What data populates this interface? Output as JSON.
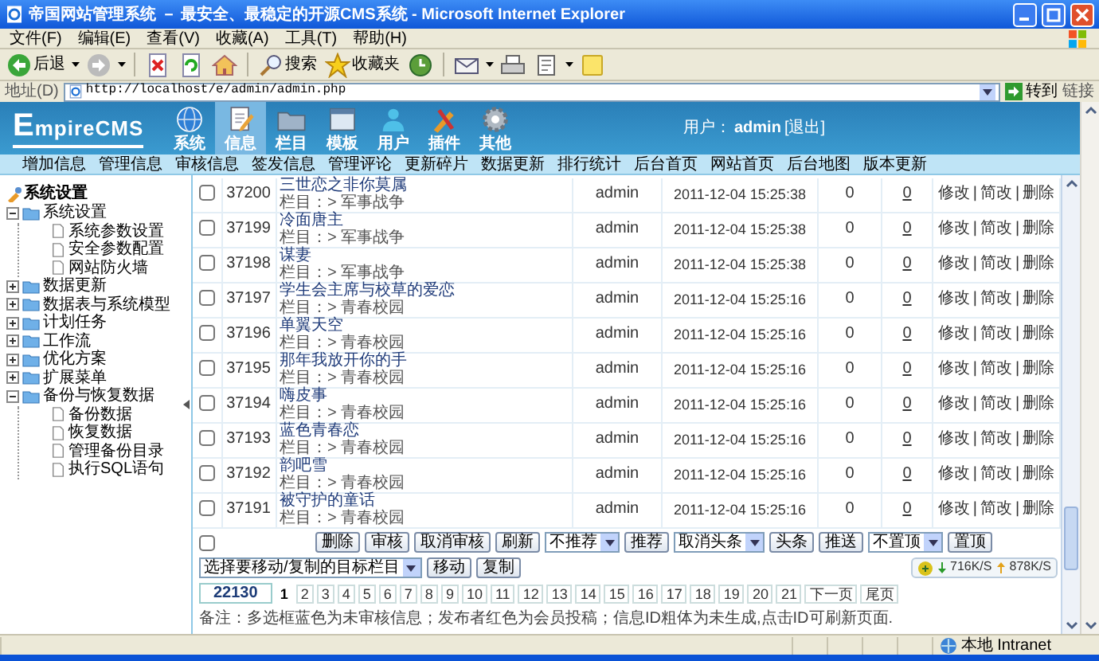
{
  "window": {
    "title": "帝国网站管理系统 － 最安全、最稳定的开源CMS系统 - Microsoft Internet Explorer"
  },
  "menu": [
    "文件(F)",
    "编辑(E)",
    "查看(V)",
    "收藏(A)",
    "工具(T)",
    "帮助(H)"
  ],
  "toolbar": [
    {
      "kind": "back",
      "label": "后退",
      "dropdown": true
    },
    {
      "kind": "forward",
      "dropdown": true
    },
    {
      "kind": "stop",
      "dropdown": false
    },
    {
      "kind": "refresh",
      "dropdown": false
    },
    {
      "kind": "home",
      "dropdown": false
    },
    {
      "kind": "search",
      "label": "搜索",
      "dropdown": false
    },
    {
      "kind": "favorites",
      "label": "收藏夹",
      "dropdown": false
    },
    {
      "kind": "history",
      "dropdown": false
    },
    {
      "kind": "mail",
      "dropdown": true
    },
    {
      "kind": "print",
      "dropdown": false
    },
    {
      "kind": "edit",
      "dropdown": true
    },
    {
      "kind": "note",
      "dropdown": false
    }
  ],
  "address_bar": {
    "label": "地址(D)",
    "url": "http://localhost/e/admin/admin.php",
    "go": "转到",
    "links": "链接"
  },
  "header": {
    "logo": "EmpireCMS",
    "user_label": "用户：",
    "user": "admin",
    "logout": "[退出]",
    "tabs": [
      {
        "kind": "globe",
        "label": "系统",
        "selected": false
      },
      {
        "kind": "document",
        "label": "信息",
        "selected": true
      },
      {
        "kind": "folder",
        "label": "栏目",
        "selected": false
      },
      {
        "kind": "template",
        "label": "模板",
        "selected": false
      },
      {
        "kind": "user",
        "label": "用户",
        "selected": false
      },
      {
        "kind": "plugin",
        "label": "插件",
        "selected": false
      },
      {
        "kind": "gear",
        "label": "其他",
        "selected": false
      }
    ]
  },
  "subnav": [
    "增加信息",
    "管理信息",
    "审核信息",
    "签发信息",
    "管理评论",
    "更新碎片",
    "数据更新",
    "排行统计",
    "后台首页",
    "网站首页",
    "后台地图",
    "版本更新"
  ],
  "sidebar": {
    "title": "系统设置",
    "items": [
      {
        "label": "系统设置",
        "expanded": true,
        "children": [
          {
            "label": "系统参数设置"
          },
          {
            "label": "安全参数配置"
          },
          {
            "label": "网站防火墙"
          }
        ]
      },
      {
        "label": "数据更新",
        "expanded": false
      },
      {
        "label": "数据表与系统模型",
        "expanded": false
      },
      {
        "label": "计划任务",
        "expanded": false
      },
      {
        "label": "工作流",
        "expanded": false
      },
      {
        "label": "优化方案",
        "expanded": false
      },
      {
        "label": "扩展菜单",
        "expanded": false
      },
      {
        "label": "备份与恢复数据",
        "expanded": true,
        "children": [
          {
            "label": "备份数据"
          },
          {
            "label": "恢复数据"
          },
          {
            "label": "管理备份目录"
          },
          {
            "label": "执行SQL语句"
          }
        ]
      }
    ]
  },
  "table": {
    "rows": [
      {
        "checked": false,
        "id": "37200",
        "title": "三世恋之非你莫属",
        "column": "栏目：> 军事战争",
        "author": "admin",
        "time": "2011-12-04 15:25:38",
        "column_6": "0",
        "column_7": "0",
        "actions": [
          "修改",
          "简改",
          "删除"
        ],
        "separator": "|"
      },
      {
        "checked": false,
        "id": "37199",
        "title": "冷面唐主",
        "column": "栏目：> 军事战争",
        "author": "admin",
        "time": "2011-12-04 15:25:38",
        "column_6": "0",
        "column_7": "0",
        "actions": [
          "修改",
          "简改",
          "删除"
        ],
        "separator": "|"
      },
      {
        "checked": false,
        "id": "37198",
        "title": "谋妻",
        "column": "栏目：> 军事战争",
        "author": "admin",
        "time": "2011-12-04 15:25:38",
        "column_6": "0",
        "column_7": "0",
        "actions": [
          "修改",
          "简改",
          "删除"
        ],
        "separator": "|"
      },
      {
        "checked": false,
        "id": "37197",
        "title": "学生会主席与校草的爱恋",
        "column": "栏目：> 青春校园",
        "author": "admin",
        "time": "2011-12-04 15:25:16",
        "column_6": "0",
        "column_7": "0",
        "actions": [
          "修改",
          "简改",
          "删除"
        ],
        "separator": "|"
      },
      {
        "checked": false,
        "id": "37196",
        "title": "单翼天空",
        "column": "栏目：> 青春校园",
        "author": "admin",
        "time": "2011-12-04 15:25:16",
        "column_6": "0",
        "column_7": "0",
        "actions": [
          "修改",
          "简改",
          "删除"
        ],
        "separator": "|"
      },
      {
        "checked": false,
        "id": "37195",
        "title": "那年我放开你的手",
        "column": "栏目：> 青春校园",
        "author": "admin",
        "time": "2011-12-04 15:25:16",
        "column_6": "0",
        "column_7": "0",
        "actions": [
          "修改",
          "简改",
          "删除"
        ],
        "separator": "|"
      },
      {
        "checked": false,
        "id": "37194",
        "title": "嗨皮事",
        "column": "栏目：> 青春校园",
        "author": "admin",
        "time": "2011-12-04 15:25:16",
        "column_6": "0",
        "column_7": "0",
        "actions": [
          "修改",
          "简改",
          "删除"
        ],
        "separator": "|"
      },
      {
        "checked": false,
        "id": "37193",
        "title": "蓝色青春恋",
        "column": "栏目：> 青春校园",
        "author": "admin",
        "time": "2011-12-04 15:25:16",
        "column_6": "0",
        "column_7": "0",
        "actions": [
          "修改",
          "简改",
          "删除"
        ],
        "separator": "|"
      },
      {
        "checked": false,
        "id": "37192",
        "title": "韵吧雪",
        "column": "栏目：> 青春校园",
        "author": "admin",
        "time": "2011-12-04 15:25:16",
        "column_6": "0",
        "column_7": "0",
        "actions": [
          "修改",
          "简改",
          "删除"
        ],
        "separator": "|"
      },
      {
        "checked": false,
        "id": "37191",
        "title": "被守护的童话",
        "column": "栏目：> 青春校园",
        "author": "admin",
        "time": "2011-12-04 15:25:16",
        "column_6": "0",
        "column_7": "0",
        "actions": [
          "修改",
          "简改",
          "删除"
        ],
        "separator": "|"
      }
    ]
  },
  "bulk_actions": {
    "select_all_checked": false,
    "controls": [
      {
        "kind": "button",
        "label": "删除"
      },
      {
        "kind": "button",
        "label": "审核"
      },
      {
        "kind": "button",
        "label": "取消审核"
      },
      {
        "kind": "button",
        "label": "刷新"
      },
      {
        "kind": "select",
        "label": "不推荐"
      },
      {
        "kind": "button",
        "label": "推荐"
      },
      {
        "kind": "select",
        "label": "取消头条"
      },
      {
        "kind": "button",
        "label": "头条"
      },
      {
        "kind": "button",
        "label": "推送"
      },
      {
        "kind": "select",
        "label": "不置顶"
      },
      {
        "kind": "button",
        "label": "置顶"
      },
      {
        "kind": "select",
        "label": "选择要移动/复制的目标栏目"
      },
      {
        "kind": "button",
        "label": "移动"
      },
      {
        "kind": "button",
        "label": "复制"
      }
    ]
  },
  "pagination": {
    "total": "22130",
    "pages": [
      {
        "label": "1",
        "selected": true
      },
      {
        "label": "2",
        "selected": false
      },
      {
        "label": "3",
        "selected": false
      },
      {
        "label": "4",
        "selected": false
      },
      {
        "label": "5",
        "selected": false
      },
      {
        "label": "6",
        "selected": false
      },
      {
        "label": "7",
        "selected": false
      },
      {
        "label": "8",
        "selected": false
      },
      {
        "label": "9",
        "selected": false
      },
      {
        "label": "10",
        "selected": false
      },
      {
        "label": "11",
        "selected": false
      },
      {
        "label": "12",
        "selected": false
      },
      {
        "label": "13",
        "selected": false
      },
      {
        "label": "14",
        "selected": false
      },
      {
        "label": "15",
        "selected": false
      },
      {
        "label": "16",
        "selected": false
      },
      {
        "label": "17",
        "selected": false
      },
      {
        "label": "18",
        "selected": false
      },
      {
        "label": "19",
        "selected": false
      },
      {
        "label": "20",
        "selected": false
      },
      {
        "label": "21",
        "selected": false
      }
    ],
    "next": "下一页",
    "last": "尾页"
  },
  "note": "备注：多选框蓝色为未审核信息；发布者红色为会员投稿；信息ID粗体为未生成,点击ID可刷新页面.",
  "net_widget": {
    "download": "716K/S",
    "upload": "878K/S"
  },
  "status_bar": {
    "zone": "本地 Intranet"
  }
}
